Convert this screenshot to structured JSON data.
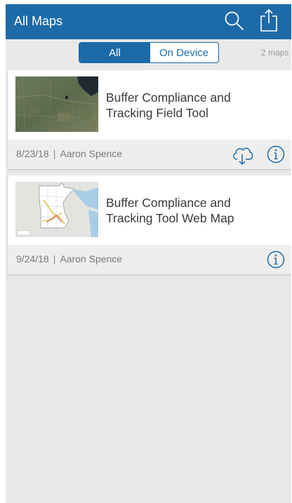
{
  "header": {
    "title": "All Maps",
    "icons": [
      "search-icon",
      "share-icon"
    ],
    "color": "#1d6aa8"
  },
  "filter": {
    "tabs": [
      "All",
      "On Device"
    ],
    "selected": "All",
    "count_label": "2 maps"
  },
  "maps": [
    {
      "title_line1": "Buffer Compliance and",
      "title_line2": "Tracking Field Tool",
      "date": "8/23/18",
      "author": "Aaron Spence",
      "actions": [
        "download-cloud-icon",
        "info-icon"
      ],
      "thumbnail": "satellite-imagery-thumbnail"
    },
    {
      "title_line1": "Buffer Compliance and",
      "title_line2": "Tracking Tool Web Map",
      "date": "9/24/18",
      "author": "Aaron Spence",
      "actions": [
        "info-icon"
      ],
      "thumbnail": "minnesota-map-thumbnail"
    }
  ]
}
